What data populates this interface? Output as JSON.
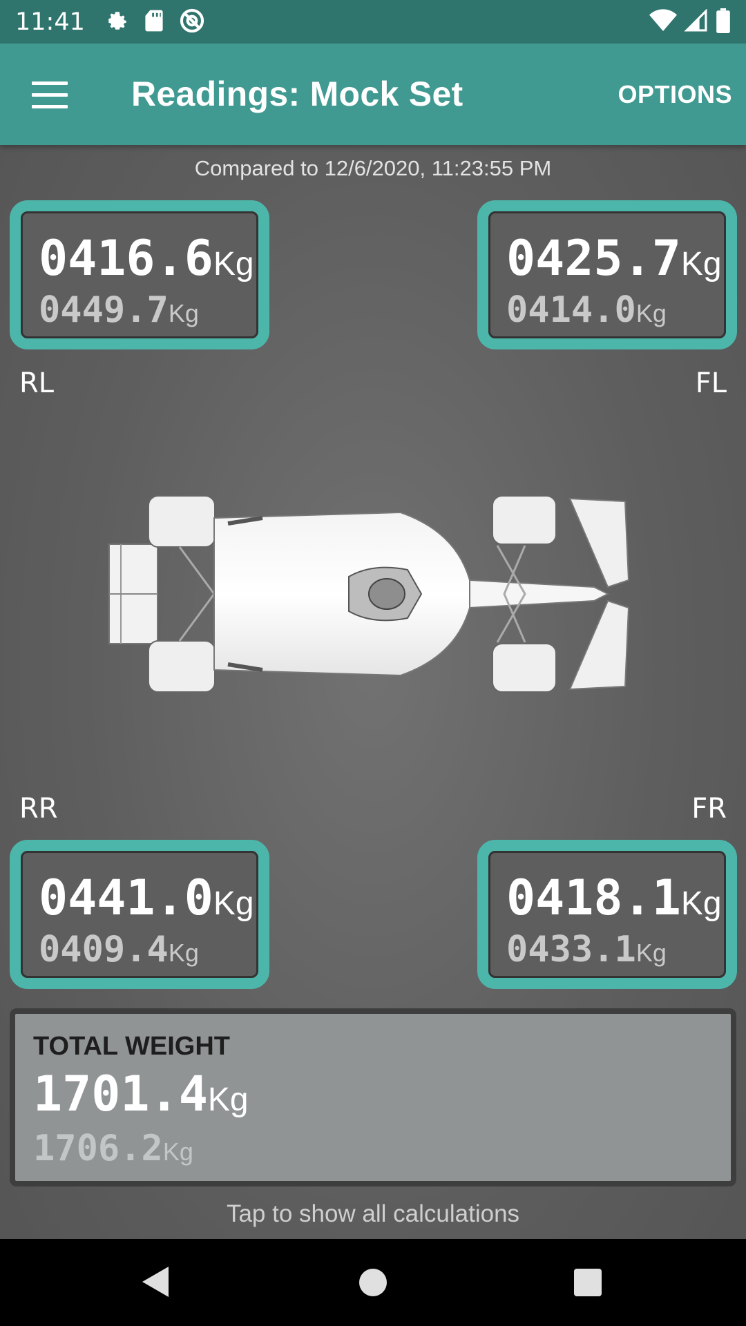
{
  "status_bar": {
    "time": "11:41",
    "icons_left": [
      "gear-icon",
      "sd-card-icon",
      "at-sign-icon"
    ],
    "icons_right": [
      "wifi-icon",
      "signal-icon",
      "battery-icon"
    ]
  },
  "app_bar": {
    "title": "Readings: Mock Set",
    "options_label": "OPTIONS"
  },
  "compared_text": "Compared to 12/6/2020, 11:23:55 PM",
  "readings": {
    "rl": {
      "label": "RL",
      "current": "0416.6",
      "previous": "0449.7",
      "unit": "Kg"
    },
    "fl": {
      "label": "FL",
      "current": "0425.7",
      "previous": "0414.0",
      "unit": "Kg"
    },
    "rr": {
      "label": "RR",
      "current": "0441.0",
      "previous": "0409.4",
      "unit": "Kg"
    },
    "fr": {
      "label": "FR",
      "current": "0418.1",
      "previous": "0433.1",
      "unit": "Kg"
    }
  },
  "total": {
    "label": "TOTAL WEIGHT",
    "current": "1701.4",
    "previous": "1706.2",
    "unit": "Kg"
  },
  "tap_text": "Tap to show all calculations",
  "colors": {
    "status_bar": "#2f756d",
    "app_bar": "#409a91",
    "card_border": "#4db6ab",
    "total_bg": "#909495"
  }
}
